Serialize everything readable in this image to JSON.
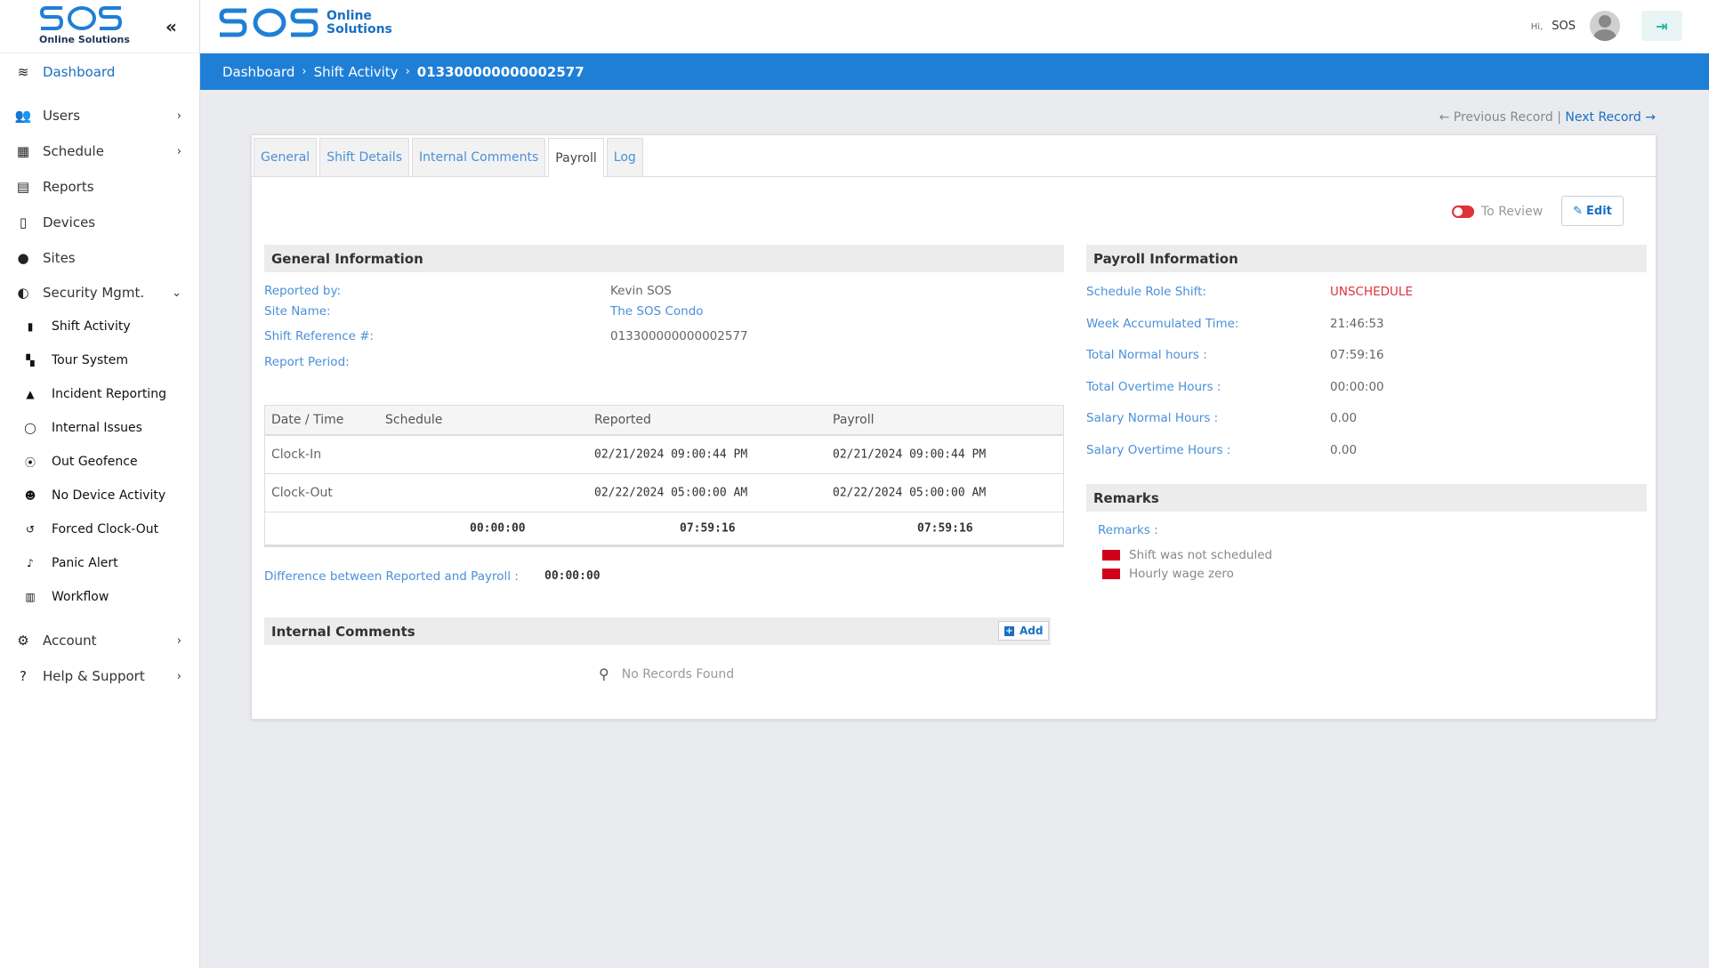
{
  "sidebar": {
    "brand": "Online Solutions",
    "collapse_icon": "double-chevron-left-icon",
    "items": [
      {
        "label": "Dashboard",
        "icon": "layers-icon"
      },
      {
        "label": "Users",
        "icon": "users-icon"
      },
      {
        "label": "Schedule",
        "icon": "calendar-icon"
      },
      {
        "label": "Reports",
        "icon": "pdf-file-icon"
      },
      {
        "label": "Devices",
        "icon": "mobile-icon"
      },
      {
        "label": "Sites",
        "icon": "map-pin-icon"
      },
      {
        "label": "Security Mgmt.",
        "icon": "shield-icon"
      }
    ],
    "sub_items": [
      {
        "label": "Shift Activity",
        "icon": "file-icon"
      },
      {
        "label": "Tour System",
        "icon": "grid-icon"
      },
      {
        "label": "Incident Reporting",
        "icon": "warning-icon"
      },
      {
        "label": "Internal Issues",
        "icon": "comment-icon"
      },
      {
        "label": "Out Geofence",
        "icon": "map-pin-icon"
      },
      {
        "label": "No Device Activity",
        "icon": "user-slash-icon"
      },
      {
        "label": "Forced Clock-Out",
        "icon": "history-icon"
      },
      {
        "label": "Panic Alert",
        "icon": "bell-icon"
      },
      {
        "label": "Workflow",
        "icon": "clipboard-icon"
      }
    ],
    "bottom_items": [
      {
        "label": "Account",
        "icon": "user-gear-icon"
      },
      {
        "label": "Help & Support",
        "icon": "question-icon"
      }
    ]
  },
  "header": {
    "logo_text_1": "Online",
    "logo_text_2": "Solutions",
    "greeting": "Hi,",
    "username": "SOS"
  },
  "breadcrumb": {
    "items": [
      "Dashboard",
      "Shift Activity"
    ],
    "current": "013300000000002577"
  },
  "record_nav": {
    "previous": "Previous Record",
    "separator": "|",
    "next": "Next Record"
  },
  "tabs": [
    "General",
    "Shift Details",
    "Internal Comments",
    "Payroll",
    "Log"
  ],
  "active_tab": "Payroll",
  "toolbar": {
    "review_label": "To Review",
    "edit_label": "Edit"
  },
  "general": {
    "title": "General Information",
    "reported_by_label": "Reported by:",
    "reported_by": "Kevin SOS",
    "site_name_label": "Site Name:",
    "site_name": "The SOS Condo",
    "shift_ref_label": "Shift Reference #:",
    "shift_ref": "013300000000002577",
    "report_period_label": "Report Period:"
  },
  "times_table": {
    "headers": [
      "Date / Time",
      "Schedule",
      "Reported",
      "Payroll"
    ],
    "rows": [
      {
        "label": "Clock-In",
        "schedule": "",
        "reported": "02/21/2024 09:00:44 PM",
        "payroll": "02/21/2024 09:00:44 PM"
      },
      {
        "label": "Clock-Out",
        "schedule": "",
        "reported": "02/22/2024 05:00:00 AM",
        "payroll": "02/22/2024 05:00:00 AM"
      }
    ],
    "totals": {
      "schedule": "00:00:00",
      "reported": "07:59:16",
      "payroll": "07:59:16"
    }
  },
  "difference": {
    "label": "Difference between Reported and Payroll :",
    "value": "00:00:00"
  },
  "internal_comments": {
    "title": "Internal Comments",
    "add_label": "Add",
    "empty": "No Records Found"
  },
  "payroll": {
    "title": "Payroll Information",
    "schedule_role_label": "Schedule Role Shift:",
    "schedule_role": "UNSCHEDULE",
    "week_accum_label": "Week Accumulated Time:",
    "week_accum": "21:46:53",
    "normal_hours_label": "Total Normal hours :",
    "normal_hours": "07:59:16",
    "overtime_hours_label": "Total Overtime Hours :",
    "overtime_hours": "00:00:00",
    "salary_normal_label": "Salary Normal Hours :",
    "salary_normal": "0.00",
    "salary_overtime_label": "Salary Overtime Hours :",
    "salary_overtime": "0.00"
  },
  "remarks": {
    "title": "Remarks",
    "label": "Remarks :",
    "items": [
      "Shift was not scheduled",
      "Hourly wage zero"
    ]
  },
  "colors": {
    "primary": "#1f7fd6",
    "link": "#4a90d9",
    "danger": "#e0303a",
    "flag": "#d0021b"
  }
}
